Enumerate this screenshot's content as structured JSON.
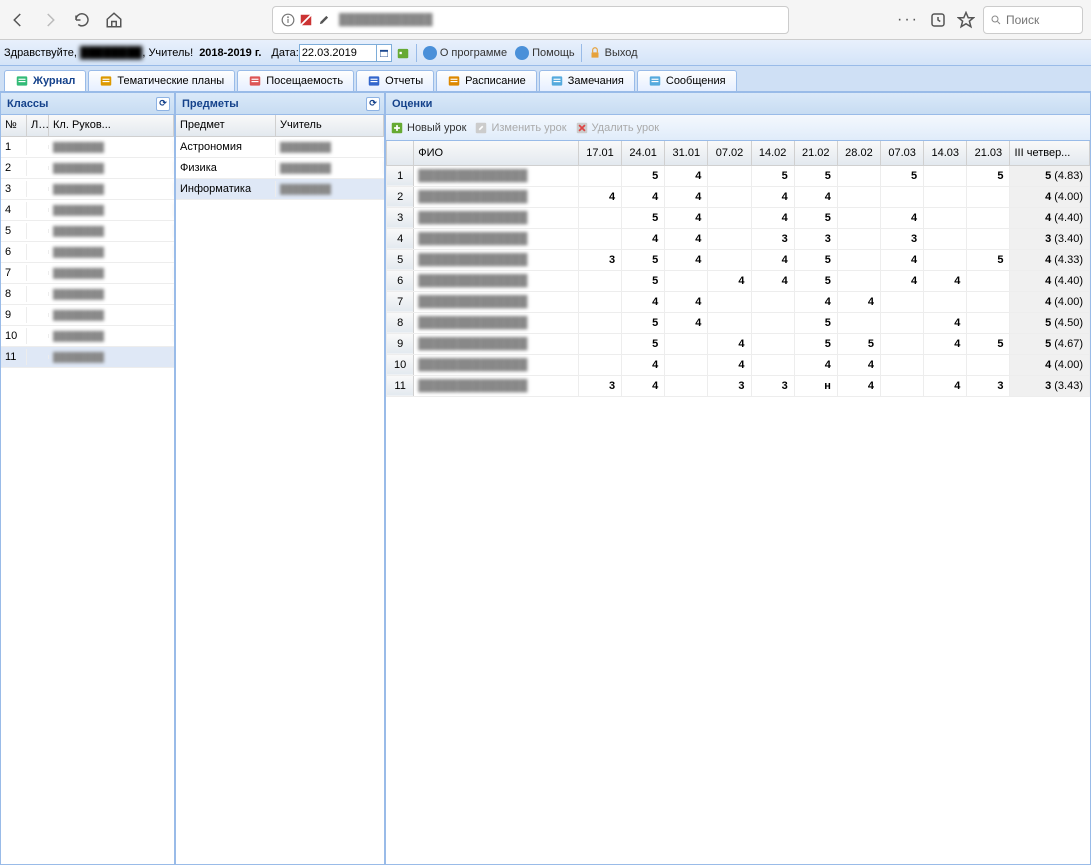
{
  "browser": {
    "search_placeholder": "Поиск"
  },
  "topbar": {
    "greeting_prefix": "Здравствуйте, ",
    "greeting_redacted": "████████",
    "role": "Учитель!",
    "year": "2018-2019 г.",
    "date_label": "Дата:",
    "date_value": "22.03.2019",
    "about": "О программе",
    "help": "Помощь",
    "exit": "Выход"
  },
  "tabs": [
    {
      "label": "Журнал",
      "active": true
    },
    {
      "label": "Тематические планы",
      "active": false
    },
    {
      "label": "Посещаемость",
      "active": false
    },
    {
      "label": "Отчеты",
      "active": false
    },
    {
      "label": "Расписание",
      "active": false
    },
    {
      "label": "Замечания",
      "active": false
    },
    {
      "label": "Сообщения",
      "active": false
    }
  ],
  "classes_panel": {
    "title": "Классы",
    "cols": {
      "no": "№",
      "l": "Л...",
      "ruk": "Кл. Руков..."
    },
    "rows": [
      {
        "no": "1"
      },
      {
        "no": "2"
      },
      {
        "no": "3"
      },
      {
        "no": "4"
      },
      {
        "no": "5"
      },
      {
        "no": "6"
      },
      {
        "no": "7"
      },
      {
        "no": "8"
      },
      {
        "no": "9"
      },
      {
        "no": "10"
      },
      {
        "no": "11",
        "selected": true
      }
    ]
  },
  "subjects_panel": {
    "title": "Предметы",
    "cols": {
      "subj": "Предмет",
      "teach": "Учитель"
    },
    "rows": [
      {
        "subj": "Астрономия"
      },
      {
        "subj": "Физика"
      },
      {
        "subj": "Информатика",
        "selected": true
      }
    ]
  },
  "grades_panel": {
    "title": "Оценки",
    "toolbar": {
      "new": "Новый урок",
      "edit": "Изменить урок",
      "del": "Удалить урок"
    },
    "cols": {
      "fio": "ФИО",
      "dates": [
        "17.01",
        "24.01",
        "31.01",
        "07.02",
        "14.02",
        "21.02",
        "28.02",
        "07.03",
        "14.03",
        "21.03"
      ],
      "summary": "III четвер..."
    },
    "rows": [
      {
        "n": 1,
        "grades": [
          "",
          "5",
          "4",
          "",
          "5",
          "5",
          "",
          "5",
          "",
          "5"
        ],
        "sum_g": "5",
        "sum_avg": "(4.83)"
      },
      {
        "n": 2,
        "grades": [
          "4",
          "4",
          "4",
          "",
          "4",
          "4",
          "",
          "",
          "",
          ""
        ],
        "sum_g": "4",
        "sum_avg": "(4.00)"
      },
      {
        "n": 3,
        "grades": [
          "",
          "5",
          "4",
          "",
          "4",
          "5",
          "",
          "4",
          "",
          ""
        ],
        "sum_g": "4",
        "sum_avg": "(4.40)"
      },
      {
        "n": 4,
        "grades": [
          "",
          "4",
          "4",
          "",
          "3",
          "3",
          "",
          "3",
          "",
          ""
        ],
        "sum_g": "3",
        "sum_avg": "(3.40)"
      },
      {
        "n": 5,
        "grades": [
          "3",
          "5",
          "4",
          "",
          "4",
          "5",
          "",
          "4",
          "",
          "5"
        ],
        "sum_g": "4",
        "sum_avg": "(4.33)"
      },
      {
        "n": 6,
        "grades": [
          "",
          "5",
          "",
          "4",
          "4",
          "5",
          "",
          "4",
          "4",
          ""
        ],
        "sum_g": "4",
        "sum_avg": "(4.40)"
      },
      {
        "n": 7,
        "grades": [
          "",
          "4",
          "4",
          "",
          "",
          "4",
          "4",
          "",
          "",
          ""
        ],
        "sum_g": "4",
        "sum_avg": "(4.00)"
      },
      {
        "n": 8,
        "grades": [
          "",
          "5",
          "4",
          "",
          "",
          "5",
          "",
          "",
          "4",
          ""
        ],
        "sum_g": "5",
        "sum_avg": "(4.50)"
      },
      {
        "n": 9,
        "grades": [
          "",
          "5",
          "",
          "4",
          "",
          "5",
          "5",
          "",
          "4",
          "5"
        ],
        "sum_g": "5",
        "sum_avg": "(4.67)"
      },
      {
        "n": 10,
        "grades": [
          "",
          "4",
          "",
          "4",
          "",
          "4",
          "4",
          "",
          "",
          ""
        ],
        "sum_g": "4",
        "sum_avg": "(4.00)"
      },
      {
        "n": 11,
        "grades": [
          "3",
          "4",
          "",
          "3",
          "3",
          "н",
          "4",
          "",
          "4",
          "3"
        ],
        "sum_g": "3",
        "sum_avg": "(3.43)"
      }
    ]
  }
}
